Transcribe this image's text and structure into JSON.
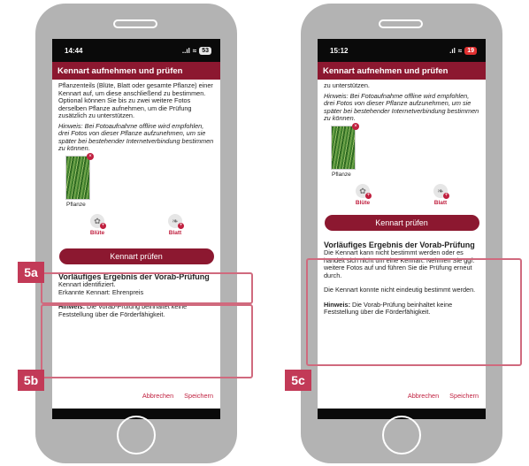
{
  "colors": {
    "brand": "#8c1830",
    "accent": "#c0203f",
    "highlight": "#d06a7e"
  },
  "left": {
    "time": "14:44",
    "battery": "53",
    "appbar_title": "Kennart aufnehmen und prüfen",
    "intro": "Pflanzenteils (Blüte, Blatt oder gesamte Pflanze) einer Kennart auf, um diese anschließend zu bestimmen. Optional können Sie bis zu zwei weitere Fotos derselben Pflanze aufnehmen, um die Prüfung zusätzlich zu unterstützen.",
    "hint": "Hinweis: Bei Fotoaufnahme offline wird empfohlen, drei Fotos von dieser Pflanze aufzunehmen, um sie später bei bestehender Internetverbindung bestimmen zu können.",
    "plant_label": "Pflanze",
    "bluete_label": "Blüte",
    "blatt_label": "Blatt",
    "check_button": "Kennart prüfen",
    "result_title": "Vorläufiges Ergebnis der Vorab-Prüfung",
    "result_line1": "Kennart identifiziert.",
    "result_line2": "Erkannte Kennart: Ehrenpreis",
    "note_bold": "Hinweis:",
    "note_text": " Die Vorab-Prüfung beinhaltet keine Feststellung über die Förderfähigkeit.",
    "cancel": "Abbrechen",
    "save": "Speichern"
  },
  "right": {
    "time": "15:12",
    "battery": "19",
    "appbar_title": "Kennart aufnehmen und prüfen",
    "intro": "zu unterstützen.",
    "hint": "Hinweis: Bei Fotoaufnahme offline wird empfohlen, drei Fotos von dieser Pflanze aufzunehmen, um sie später bei bestehender Internetverbindung bestimmen zu können.",
    "plant_label": "Pflanze",
    "bluete_label": "Blüte",
    "blatt_label": "Blatt",
    "check_button": "Kennart prüfen",
    "result_title": "Vorläufiges Ergebnis der Vorab-Prüfung",
    "result_text1": "Die Kennart kann nicht bestimmt werden oder es handelt sich nicht um eine Kennart. Nehmen Sie ggf. weitere Fotos auf und führen Sie die Prüfung erneut durch.",
    "result_text2": "Die Kennart konnte nicht eindeutig bestimmt werden.",
    "note_bold": "Hinweis:",
    "note_text": " Die Vorab-Prüfung beinhaltet keine Feststellung über die Förderfähigkeit.",
    "cancel": "Abbrechen",
    "save": "Speichern"
  },
  "callouts": {
    "a": "5a",
    "b": "5b",
    "c": "5c"
  }
}
